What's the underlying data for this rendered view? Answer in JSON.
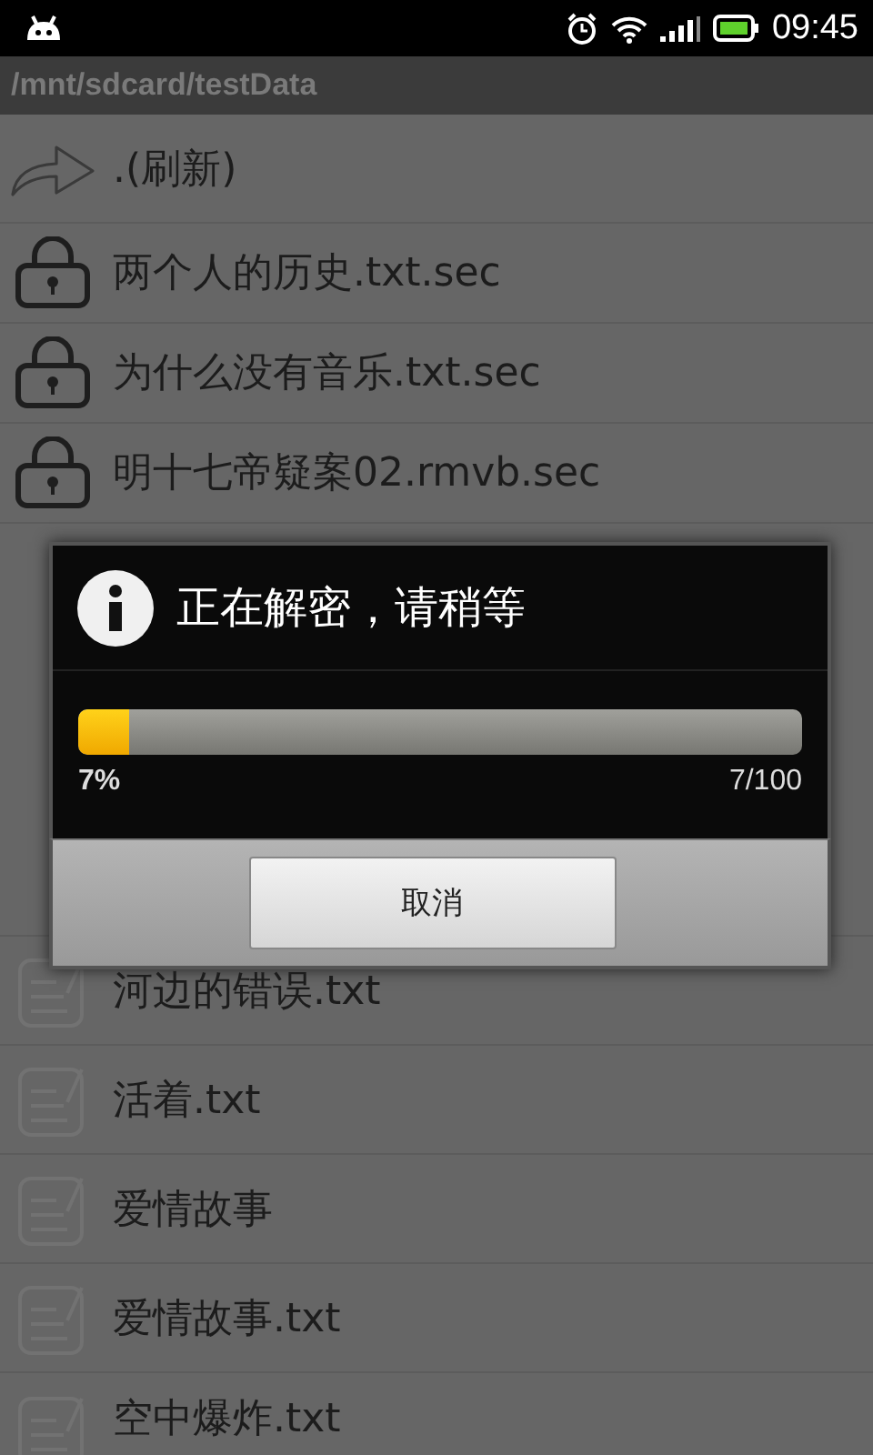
{
  "status_bar": {
    "time": "09:45"
  },
  "path": "/mnt/sdcard/testData",
  "files": [
    {
      "kind": "refresh",
      "name": ".(刷新)"
    },
    {
      "kind": "locked",
      "name": "两个人的历史.txt.sec"
    },
    {
      "kind": "locked",
      "name": "为什么没有音乐.txt.sec"
    },
    {
      "kind": "locked",
      "name": "明十七帝疑案02.rmvb.sec"
    },
    {
      "kind": "gap"
    },
    {
      "kind": "document",
      "name": "河边的错误.txt"
    },
    {
      "kind": "document",
      "name": "活着.txt"
    },
    {
      "kind": "document",
      "name": "爱情故事"
    },
    {
      "kind": "document",
      "name": "爱情故事.txt"
    },
    {
      "kind": "document",
      "name": "空中爆炸.txt"
    }
  ],
  "dialog": {
    "title": "正在解密，请稍等",
    "progress": {
      "level": 0.07,
      "percent": "7%",
      "count": "7/100"
    },
    "buttons": [
      "取消"
    ]
  }
}
